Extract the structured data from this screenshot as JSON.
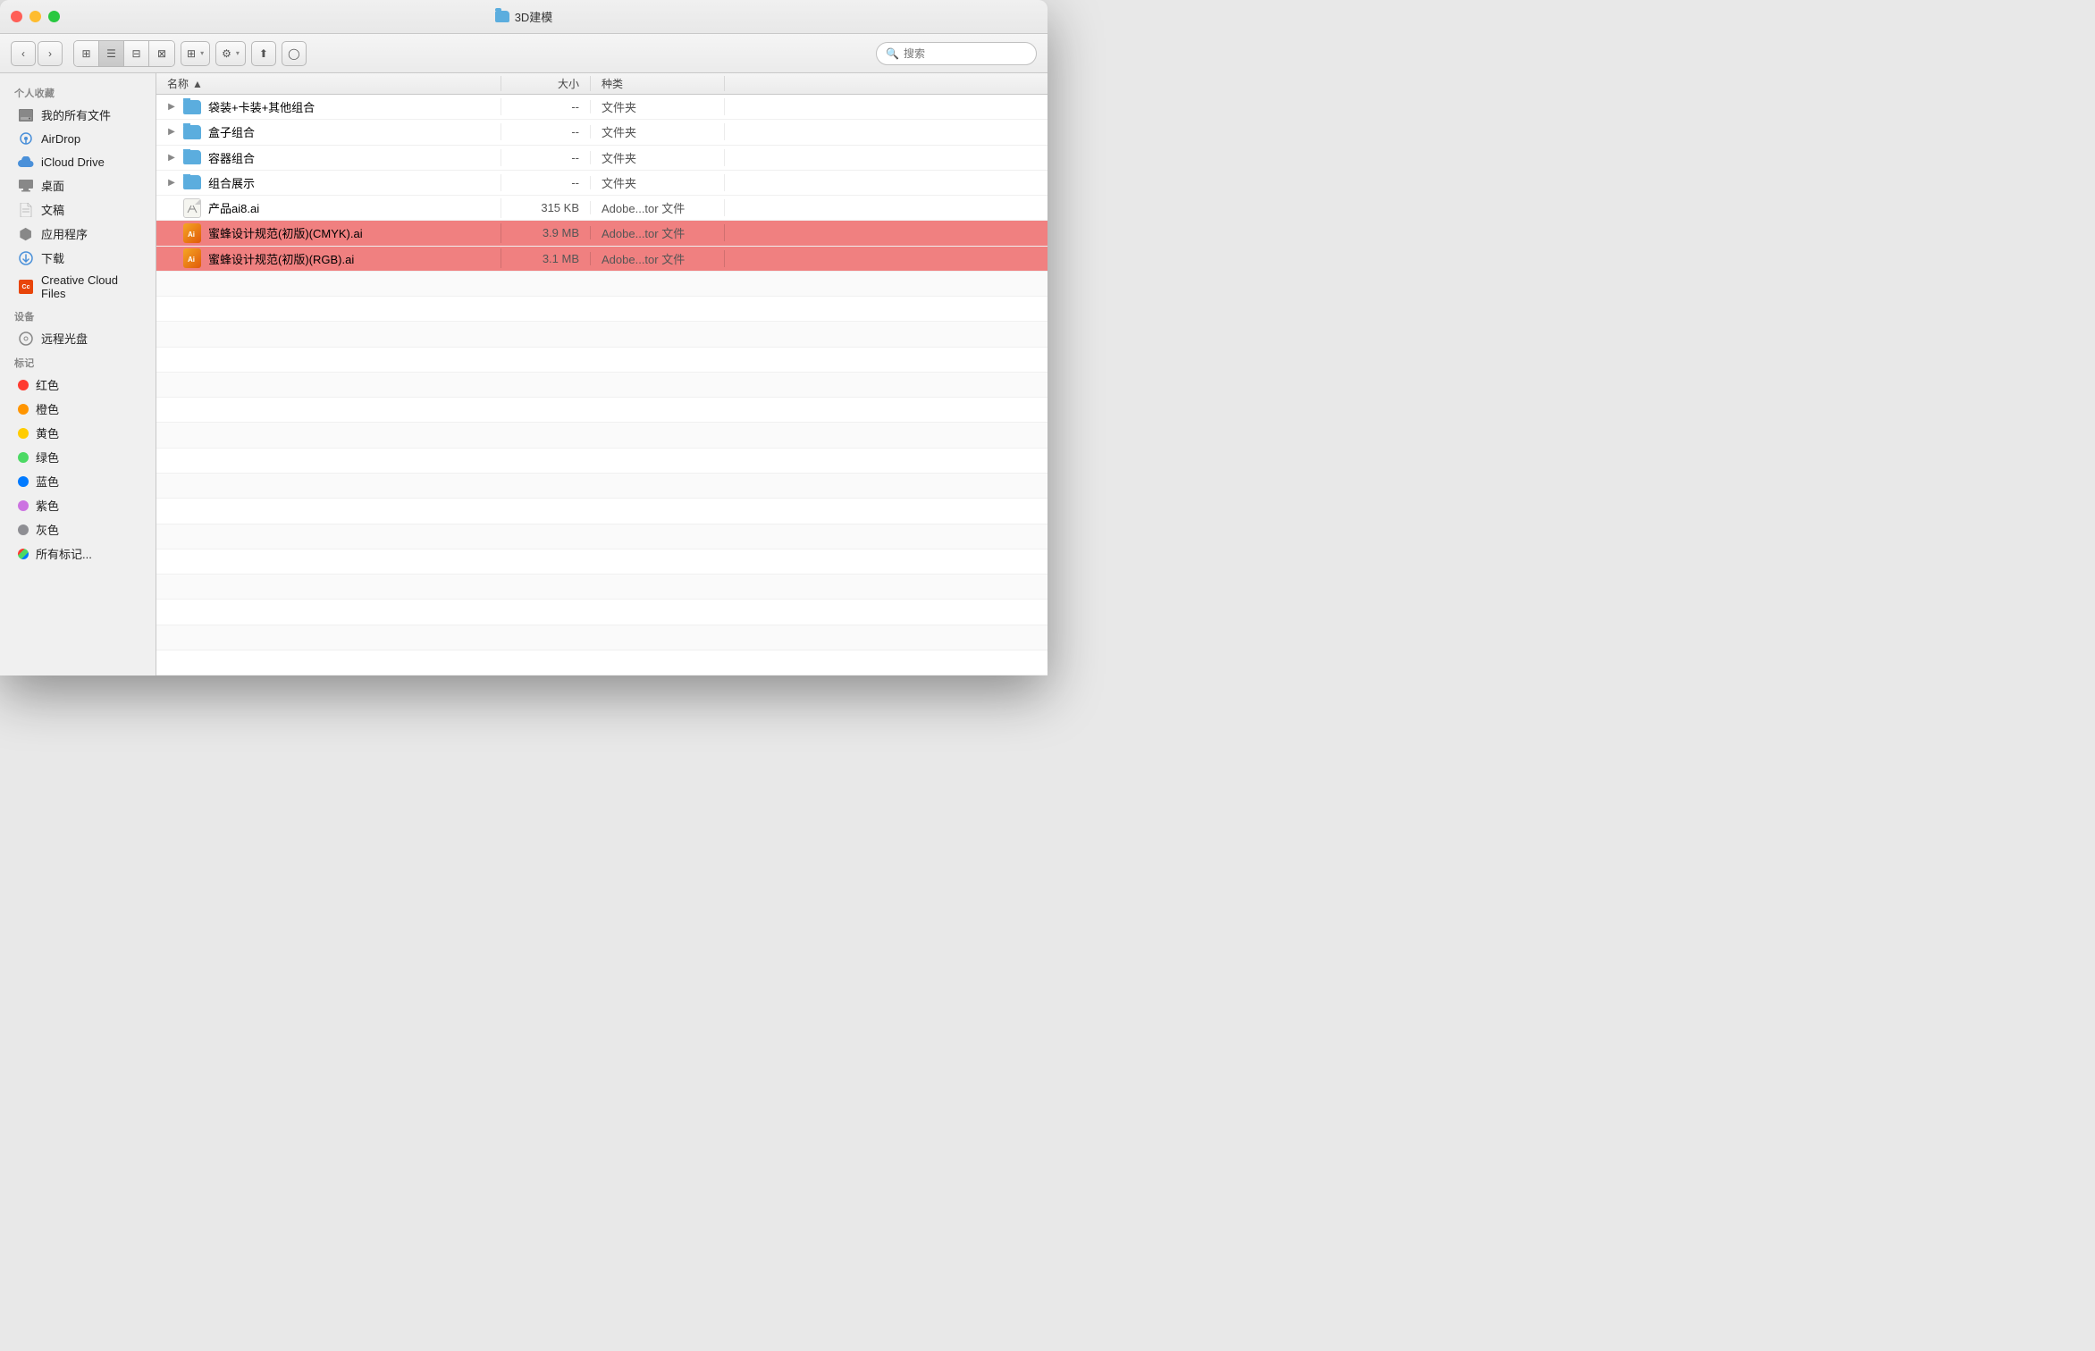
{
  "window": {
    "title": "3D建模",
    "folder_icon_color": "#5badde"
  },
  "toolbar": {
    "back_label": "‹",
    "forward_label": "›",
    "view_icons": [
      "⊞",
      "☰",
      "⊟",
      "⊠"
    ],
    "action_label": "⚙",
    "share_label": "↑",
    "tag_label": "○",
    "search_placeholder": "搜索"
  },
  "sidebar": {
    "personal_section": "个人收藏",
    "items": [
      {
        "id": "all-files",
        "label": "我的所有文件",
        "icon": "hdd"
      },
      {
        "id": "airdrop",
        "label": "AirDrop",
        "icon": "airdrop"
      },
      {
        "id": "icloud",
        "label": "iCloud Drive",
        "icon": "cloud"
      },
      {
        "id": "desktop",
        "label": "桌面",
        "icon": "desktop"
      },
      {
        "id": "documents",
        "label": "文稿",
        "icon": "doc"
      },
      {
        "id": "applications",
        "label": "应用程序",
        "icon": "apps"
      },
      {
        "id": "downloads",
        "label": "下载",
        "icon": "download"
      },
      {
        "id": "cc-files",
        "label": "Creative Cloud Files",
        "icon": "cc"
      }
    ],
    "devices_section": "设备",
    "devices": [
      {
        "id": "optical",
        "label": "远程光盘",
        "icon": "optical"
      }
    ],
    "tags_section": "标记",
    "tags": [
      {
        "id": "red",
        "label": "红色",
        "color": "#ff3b30"
      },
      {
        "id": "orange",
        "label": "橙色",
        "color": "#ff9500"
      },
      {
        "id": "yellow",
        "label": "黄色",
        "color": "#ffcc00"
      },
      {
        "id": "green",
        "label": "绿色",
        "color": "#4cd964"
      },
      {
        "id": "blue",
        "label": "蓝色",
        "color": "#007aff"
      },
      {
        "id": "purple",
        "label": "紫色",
        "color": "#cc73e1"
      },
      {
        "id": "gray",
        "label": "灰色",
        "color": "#8e8e93"
      },
      {
        "id": "all-tags",
        "label": "所有标记...",
        "color": "#c8c8c8"
      }
    ]
  },
  "content": {
    "columns": {
      "name": "名称",
      "size": "大小",
      "kind": "种类"
    },
    "files": [
      {
        "id": "folder1",
        "name": "袋装+卡装+其他组合",
        "type": "folder",
        "size": "--",
        "kind": "文件夹",
        "selected": false
      },
      {
        "id": "folder2",
        "name": "盒子组合",
        "type": "folder",
        "size": "--",
        "kind": "文件夹",
        "selected": false
      },
      {
        "id": "folder3",
        "name": "容器组合",
        "type": "folder",
        "size": "--",
        "kind": "文件夹",
        "selected": false
      },
      {
        "id": "folder4",
        "name": "组合展示",
        "type": "folder",
        "size": "--",
        "kind": "文件夹",
        "selected": false
      },
      {
        "id": "file1",
        "name": "产品ai8.ai",
        "type": "ai-plain",
        "size": "315 KB",
        "kind": "Adobe...tor 文件",
        "selected": false
      },
      {
        "id": "file2",
        "name": "蜜蜂设计规范(初版)(CMYK).ai",
        "type": "ai-orange",
        "size": "3.9 MB",
        "kind": "Adobe...tor 文件",
        "selected": true
      },
      {
        "id": "file3",
        "name": "蜜蜂设计规范(初版)(RGB).ai",
        "type": "ai-orange",
        "size": "3.1 MB",
        "kind": "Adobe...tor 文件",
        "selected": true
      }
    ]
  }
}
